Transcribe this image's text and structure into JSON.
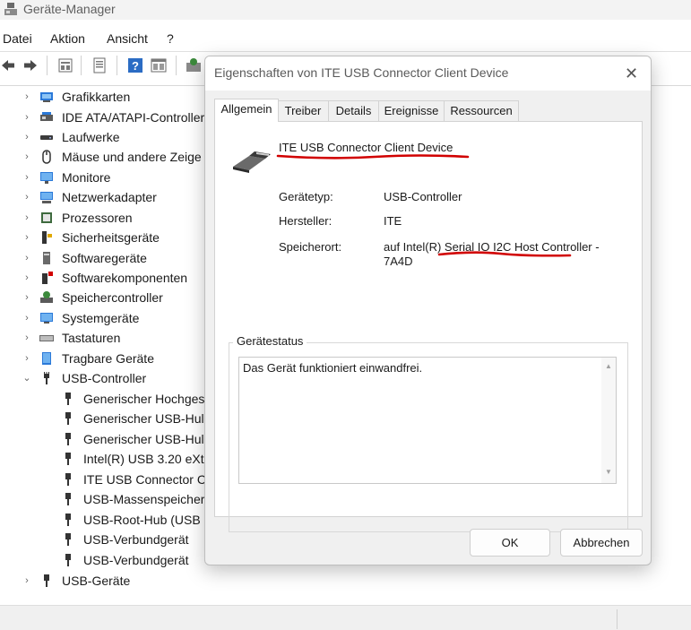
{
  "window": {
    "title": "Geräte-Manager"
  },
  "menu": {
    "items": [
      "Datei",
      "Aktion",
      "Ansicht",
      "?"
    ]
  },
  "tree": {
    "items": [
      {
        "label": "Grafikkarten",
        "icon": "display-adapter-icon"
      },
      {
        "label": "IDE ATA/ATAPI-Controller",
        "icon": "ide-controller-icon"
      },
      {
        "label": "Laufwerke",
        "icon": "drive-icon"
      },
      {
        "label": "Mäuse und andere Zeige",
        "icon": "mouse-icon"
      },
      {
        "label": "Monitore",
        "icon": "monitor-icon"
      },
      {
        "label": "Netzwerkadapter",
        "icon": "network-adapter-icon"
      },
      {
        "label": "Prozessoren",
        "icon": "processor-icon"
      },
      {
        "label": "Sicherheitsgeräte",
        "icon": "security-device-icon"
      },
      {
        "label": "Softwaregeräte",
        "icon": "software-device-icon"
      },
      {
        "label": "Softwarekomponenten",
        "icon": "software-component-icon"
      },
      {
        "label": "Speichercontroller",
        "icon": "storage-controller-icon"
      },
      {
        "label": "Systemgeräte",
        "icon": "system-device-icon"
      },
      {
        "label": "Tastaturen",
        "icon": "keyboard-icon"
      },
      {
        "label": "Tragbare Geräte",
        "icon": "portable-device-icon"
      },
      {
        "label": "USB-Controller",
        "icon": "usb-plug-icon",
        "expanded": true
      }
    ],
    "usb_children": [
      "Generischer Hochges",
      "Generischer USB-Hul",
      "Generischer USB-Hul",
      "Intel(R) USB 3.20 eXte",
      "ITE USB Connector C",
      "USB-Massenspeicher",
      "USB-Root-Hub (USB",
      "USB-Verbundgerät",
      "USB-Verbundgerät"
    ],
    "last_item": {
      "label": "USB-Geräte",
      "icon": "usb-plug-icon"
    }
  },
  "dialog": {
    "title": "Eigenschaften von ITE USB Connector Client Device",
    "tabs": [
      "Allgemein",
      "Treiber",
      "Details",
      "Ereignisse",
      "Ressourcen"
    ],
    "device_name": "ITE USB Connector Client Device",
    "properties": [
      {
        "label": "Gerätetyp:",
        "value": "USB-Controller"
      },
      {
        "label": "Hersteller:",
        "value": "ITE"
      },
      {
        "label": "Speicherort:",
        "value": "auf Intel(R) Serial IO I2C Host Controller - 7A4D"
      }
    ],
    "status_group_label": "Gerätestatus",
    "status_text": "Das Gerät funktioniert einwandfrei.",
    "ok_label": "OK",
    "cancel_label": "Abbrechen"
  },
  "colors": {
    "annotation_red": "#d10000",
    "accent_blue": "#2b6cc4"
  }
}
